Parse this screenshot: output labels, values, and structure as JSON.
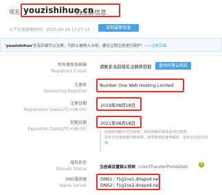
{
  "header": {
    "prefix": "域名",
    "domain": "youzishihuo.cn",
    "suffix": "的注册信息"
  },
  "query": {
    "text": "以下信息获取时间：2020-09-14 17:27:14",
    "refresh_label": "获取最新信息"
  },
  "notice": {
    "domain": "'youzishihuo'",
    "text": "还有后缀可以注册，为防止被他人占用，建议立即注册进行保护！",
    "link": ">>注册后缀"
  },
  "rows": {
    "registrant_email": {
      "label_cn": "所有者联系邮箱",
      "label_en": "Registrant E-mail",
      "value": "请联系当前域名注册商获取",
      "button": "委托阿里云购买"
    },
    "registrar": {
      "label_cn": "注册商",
      "label_en": "Sponsoring Registrar",
      "value": "Number One Web Hosting Limited"
    },
    "registration_date": {
      "label_cn": "注册日期",
      "label_en": "Registration Date(UTC+08:00)",
      "value": "2019年08月18日"
    },
    "expiration_date": {
      "label_cn": "到期日期",
      "label_en": "Expiration Date(UTC+08:00)",
      "value": "2021年08月18日"
    },
    "date_note": {
      "line1": "此域名到期日仅供参考。实际到期日期请咨询注册商。",
      "line2": "如本仅支援到期日期续费，将导致域名被停解析，如何在还站访问",
      "line3": "等。"
    },
    "domain_status": {
      "label_cn": "域名状态",
      "label_en": "Domain Status",
      "value_strong": "注册商设置禁止转移",
      "value_rest": "（clientTransferProhibited）"
    },
    "dns": {
      "label_cn": "DNS服务器",
      "label_en": "Name Server",
      "dns1": "DNS1：f1g1ns1.dnspod.net",
      "dns2": "DNS2：f1g1ns2.dnspod.net"
    }
  },
  "icons": {
    "help": "help-circle-icon"
  },
  "colors": {
    "highlight_border": "#e8322b",
    "accent_blue": "#4aa0e6",
    "help_green": "#8ab820"
  }
}
